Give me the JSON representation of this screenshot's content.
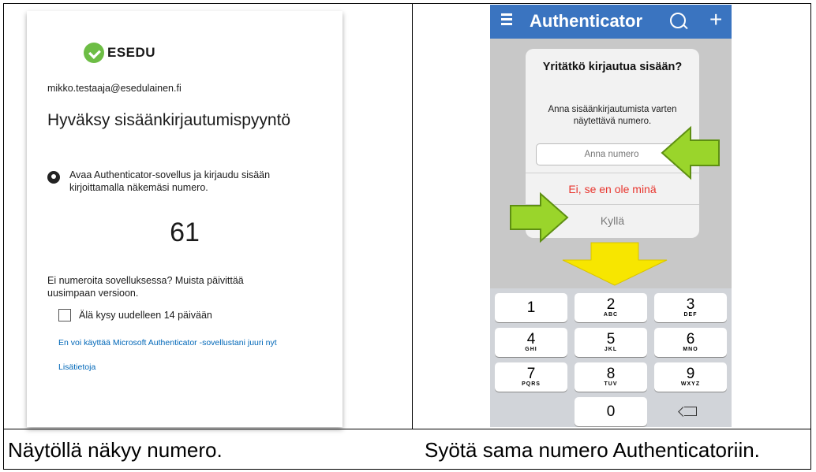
{
  "login_card": {
    "brand": "ESEDU",
    "email": "mikko.testaaja@esedulainen.fi",
    "title": "Hyväksy sisäänkirjautumispyyntö",
    "instruction": "Avaa Authenticator-sovellus ja kirjaudu sisään kirjoittamalla näkemäsi numero.",
    "number": "61",
    "hint": "Ei numeroita sovelluksessa? Muista päivittää uusimpaan versioon.",
    "checkbox_label": "Älä kysy uudelleen 14 päivään",
    "checkbox_checked": false,
    "link_cannot_use": "En voi käyttää Microsoft Authenticator -sovellustani juuri nyt",
    "link_more_info": "Lisätietoja"
  },
  "phone": {
    "app_title": "Authenticator",
    "topbar_color": "#3a74c0",
    "icons": [
      "menu-icon",
      "search-icon",
      "plus-icon"
    ],
    "dialog": {
      "title": "Yritätkö kirjautua sisään?",
      "message": "Anna sisäänkirjautumista varten näytettävä numero.",
      "input_placeholder": "Anna numero",
      "deny_label": "Ei, se en ole minä",
      "approve_label": "Kyllä"
    },
    "keypad": [
      {
        "num": "1",
        "letters": ""
      },
      {
        "num": "2",
        "letters": "ABC"
      },
      {
        "num": "3",
        "letters": "DEF"
      },
      {
        "num": "4",
        "letters": "GHI"
      },
      {
        "num": "5",
        "letters": "JKL"
      },
      {
        "num": "6",
        "letters": "MNO"
      },
      {
        "num": "7",
        "letters": "PQRS"
      },
      {
        "num": "8",
        "letters": "TUV"
      },
      {
        "num": "9",
        "letters": "WXYZ"
      },
      {
        "num": "0",
        "letters": ""
      }
    ],
    "arrow_colors": {
      "green": "#9ad52b",
      "yellow": "#f7e600"
    }
  },
  "captions": {
    "left": "Näytöllä näkyy numero.",
    "right": "Syötä sama numero Authenticatoriin."
  }
}
